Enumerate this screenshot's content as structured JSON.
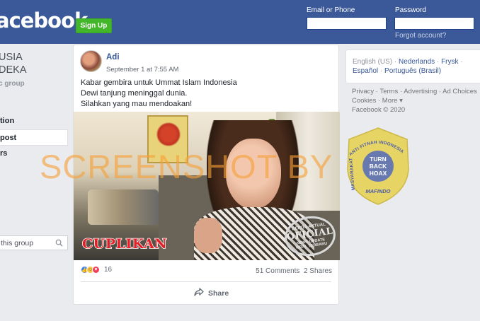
{
  "header": {
    "logo_text": "acebook",
    "signup_label": "Sign Up",
    "email_label": "Email or Phone",
    "password_label": "Password",
    "forgot_label": "Forgot account?"
  },
  "left": {
    "group_title_line1": "USIA",
    "group_title_line2": "DEKA",
    "group_sub": "c group",
    "nav": [
      {
        "label": "tion"
      },
      {
        "label": "post"
      },
      {
        "label": "rs"
      }
    ],
    "search_placeholder": "this group"
  },
  "post": {
    "author": "Adi",
    "timestamp": "September 1 at 7:55 AM",
    "lines": [
      "Kabar gembira untuk Ummat Islam Indonesia",
      "Dewi tanjung meninggal dunia.",
      "Silahkan yang mau mendoakan!"
    ],
    "video_caption": "CUPLIKAN",
    "stamp": {
      "top": "BERITA AKTUAL",
      "main": "OFICIAL",
      "sub": "NEWS UPDATE",
      "bottom": "VIRAL TERBARU"
    },
    "reaction_count": "16",
    "comments": "51 Comments",
    "shares": "2 Shares",
    "share_label": "Share"
  },
  "watermark": "SCREENSHOT BY",
  "right": {
    "languages_line1": [
      "English (US)",
      "Nederlands",
      "Frysk"
    ],
    "languages_line2": [
      "Español",
      "Português (Brasil)"
    ],
    "footer_line1": [
      "Privacy",
      "Terms",
      "Advertising",
      "Ad Choices"
    ],
    "footer_line2": [
      "Cookies",
      "More"
    ],
    "copyright": "Facebook © 2020"
  },
  "badge": {
    "arc_left": "MASYARAKAT ANTI FITNAH INDONESIA",
    "center1": "TURN",
    "center2": "BACK",
    "center3": "HOAX",
    "bottom": "MAFINDO"
  },
  "colors": {
    "header_bg": "#3b5998",
    "signup_green": "#42b72a",
    "link_blue": "#385898",
    "watermark_orange": "#f5a037",
    "badge_yellow": "#e8d45c",
    "badge_blue": "#5a6fb8"
  }
}
